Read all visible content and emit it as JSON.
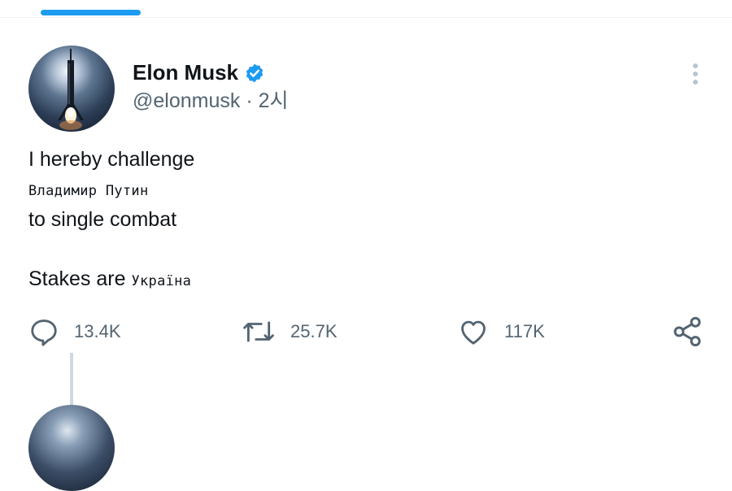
{
  "tweet": {
    "author": {
      "display_name": "Elon Musk",
      "handle": "@elonmusk",
      "time_ago": "2시",
      "verified": true,
      "avatar_icon": "rocket-launch-avatar"
    },
    "text_lines": {
      "line1": "I hereby challenge",
      "line2": "Владимир Путин",
      "line3": "to single combat",
      "line4_prefix": "Stakes are",
      "line4_suffix": "Україна"
    },
    "actions": {
      "reply": {
        "icon": "reply-icon",
        "count": "13.4K"
      },
      "retweet": {
        "icon": "retweet-icon",
        "count": "25.7K"
      },
      "like": {
        "icon": "heart-icon",
        "count": "117K"
      },
      "share": {
        "icon": "share-icon"
      }
    }
  },
  "colors": {
    "accent": "#1d9bf0",
    "text_primary": "#0f1419",
    "text_secondary": "#536471"
  }
}
